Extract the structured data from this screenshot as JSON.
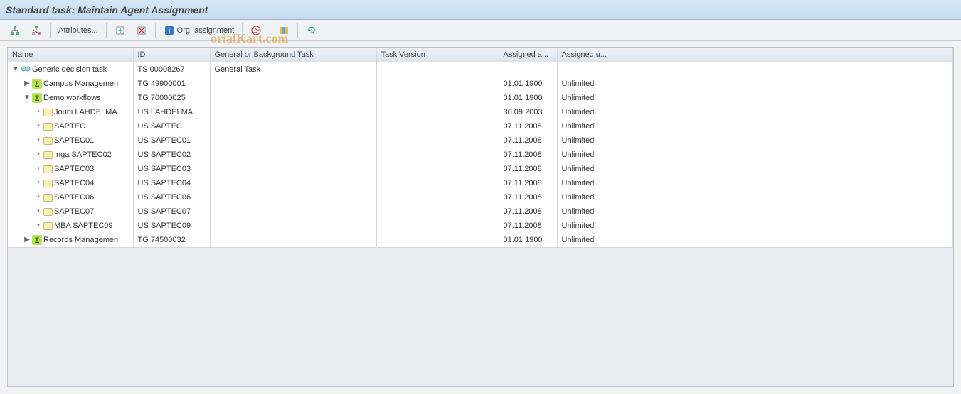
{
  "title": "Standard task: Maintain Agent Assignment",
  "toolbar": {
    "btn_hierarchy": "hierarchy",
    "btn_sever": "sever",
    "attributes_label": "Attributes...",
    "btn_create_agent_asgn": "create-agent-assignment",
    "btn_delete": "delete",
    "btn_info": "info",
    "org_assignment_label": "Org. assignment",
    "btn_world": "world",
    "btn_columns": "columns",
    "btn_refresh": "refresh"
  },
  "columns": {
    "name": "Name",
    "id": "ID",
    "task": "General or Background Task",
    "version": "Task Version",
    "assigned_as": "Assigned a...",
    "assigned_until": "Assigned u..."
  },
  "rows": [
    {
      "indent": 0,
      "expander": "open",
      "icon": "task",
      "name": "Generic decision task",
      "id": "TS 00008267",
      "task": "General Task",
      "version": "",
      "assigned_as": "",
      "assigned_until": ""
    },
    {
      "indent": 1,
      "expander": "closed",
      "icon": "sigma-green",
      "name": "Campus Managemen",
      "id": "TG 49900001",
      "task": "",
      "version": "",
      "assigned_as": "01.01.1900",
      "assigned_until": "Unlimited"
    },
    {
      "indent": 1,
      "expander": "open",
      "icon": "sigma-green",
      "name": "Demo workflows",
      "id": "TG 70000025",
      "task": "",
      "version": "",
      "assigned_as": "01.01.1900",
      "assigned_until": "Unlimited"
    },
    {
      "indent": 2,
      "expander": "leaf",
      "icon": "user-box",
      "name": "Jouni LAHDELMA",
      "id": "US LAHDELMA",
      "task": "",
      "version": "",
      "assigned_as": "30.09.2003",
      "assigned_until": "Unlimited"
    },
    {
      "indent": 2,
      "expander": "leaf",
      "icon": "user-box",
      "name": "SAPTEC",
      "id": "US SAPTEC",
      "task": "",
      "version": "",
      "assigned_as": "07.11.2008",
      "assigned_until": "Unlimited"
    },
    {
      "indent": 2,
      "expander": "leaf",
      "icon": "user-box",
      "name": "SAPTEC01",
      "id": "US SAPTEC01",
      "task": "",
      "version": "",
      "assigned_as": "07.11.2008",
      "assigned_until": "Unlimited"
    },
    {
      "indent": 2,
      "expander": "leaf",
      "icon": "user-box",
      "name": "Inga SAPTEC02",
      "id": "US SAPTEC02",
      "task": "",
      "version": "",
      "assigned_as": "07.11.2008",
      "assigned_until": "Unlimited"
    },
    {
      "indent": 2,
      "expander": "leaf",
      "icon": "user-box",
      "name": "SAPTEC03",
      "id": "US SAPTEC03",
      "task": "",
      "version": "",
      "assigned_as": "07.11.2008",
      "assigned_until": "Unlimited"
    },
    {
      "indent": 2,
      "expander": "leaf",
      "icon": "user-box",
      "name": "SAPTEC04",
      "id": "US SAPTEC04",
      "task": "",
      "version": "",
      "assigned_as": "07.11.2008",
      "assigned_until": "Unlimited"
    },
    {
      "indent": 2,
      "expander": "leaf",
      "icon": "user-box",
      "name": "SAPTEC06",
      "id": "US SAPTEC06",
      "task": "",
      "version": "",
      "assigned_as": "07.11.2008",
      "assigned_until": "Unlimited"
    },
    {
      "indent": 2,
      "expander": "leaf",
      "icon": "user-box",
      "name": "SAPTEC07",
      "id": "US SAPTEC07",
      "task": "",
      "version": "",
      "assigned_as": "07.11.2008",
      "assigned_until": "Unlimited"
    },
    {
      "indent": 2,
      "expander": "leaf",
      "icon": "user-box",
      "name": "MBA SAPTEC09",
      "id": "US SAPTEC09",
      "task": "",
      "version": "",
      "assigned_as": "07.11.2008",
      "assigned_until": "Unlimited"
    },
    {
      "indent": 1,
      "expander": "closed",
      "icon": "sigma-green",
      "name": "Records Managemen",
      "id": "TG 74500032",
      "task": "",
      "version": "",
      "assigned_as": "01.01.1900",
      "assigned_until": "Unlimited"
    }
  ],
  "watermark": "orialKart.com"
}
